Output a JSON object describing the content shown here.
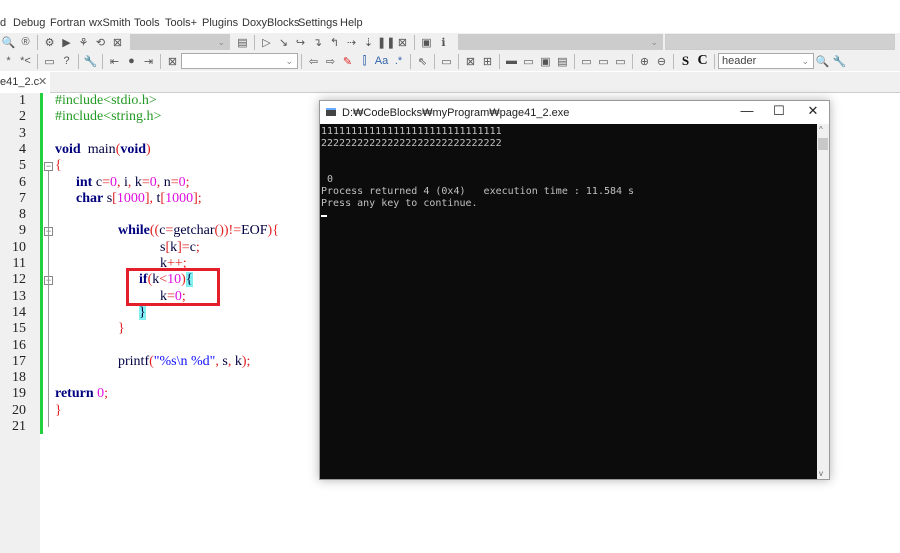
{
  "menu": [
    "d",
    "Debug",
    "Fortran",
    "wxSmith",
    "Tools",
    "Tools+",
    "Plugins",
    "DoxyBlocks",
    "Settings",
    "Help"
  ],
  "toolbar": {
    "target_combo": "",
    "search_combo": "",
    "symbol_combo": "header"
  },
  "tab": {
    "label": "e41_2.c",
    "close": "✕"
  },
  "editor": {
    "line_numbers": [
      "1",
      "2",
      "3",
      "4",
      "5",
      "6",
      "7",
      "8",
      "9",
      "10",
      "11",
      "12",
      "13",
      "14",
      "15",
      "16",
      "17",
      "18",
      "19",
      "20",
      "21"
    ],
    "lines": [
      [
        [
          "pp",
          "#include<stdio.h>"
        ]
      ],
      [
        [
          "pp",
          "#include<string.h>"
        ]
      ],
      [],
      [
        [
          "kw",
          "void"
        ],
        [
          "",
          "  main"
        ],
        [
          "op",
          "("
        ],
        [
          "kw",
          "void"
        ],
        [
          "op",
          ")"
        ]
      ],
      [
        [
          "op",
          "{"
        ]
      ],
      [
        [
          "",
          "      "
        ],
        [
          "kw",
          "int"
        ],
        [
          "",
          " c"
        ],
        [
          "op",
          "="
        ],
        [
          "num",
          "0"
        ],
        [
          "op",
          ","
        ],
        [
          "",
          " i"
        ],
        [
          "op",
          ","
        ],
        [
          "",
          " k"
        ],
        [
          "op",
          "="
        ],
        [
          "num",
          "0"
        ],
        [
          "op",
          ","
        ],
        [
          "",
          " n"
        ],
        [
          "op",
          "="
        ],
        [
          "num",
          "0"
        ],
        [
          "op",
          ";"
        ]
      ],
      [
        [
          "",
          "      "
        ],
        [
          "kw",
          "char"
        ],
        [
          "",
          " s"
        ],
        [
          "op",
          "["
        ],
        [
          "num",
          "1000"
        ],
        [
          "op",
          "]"
        ],
        [
          "op",
          ","
        ],
        [
          "",
          " t"
        ],
        [
          "op",
          "["
        ],
        [
          "num",
          "1000"
        ],
        [
          "op",
          "]"
        ],
        [
          "op",
          ";"
        ]
      ],
      [],
      [
        [
          "",
          "                  "
        ],
        [
          "kw",
          "while"
        ],
        [
          "op",
          "(("
        ],
        [
          "",
          "c"
        ],
        [
          "op",
          "="
        ],
        [
          "",
          "getchar"
        ],
        [
          "op",
          "())!="
        ],
        [
          "",
          "EOF"
        ],
        [
          "op",
          ")"
        ],
        [
          "op",
          "{"
        ]
      ],
      [
        [
          "",
          "                              "
        ],
        [
          "",
          "s"
        ],
        [
          "op",
          "["
        ],
        [
          "",
          "k"
        ],
        [
          "op",
          "]="
        ],
        [
          "",
          "c"
        ],
        [
          "op",
          ";"
        ]
      ],
      [
        [
          "",
          "                              "
        ],
        [
          "",
          "k"
        ],
        [
          "op",
          "++;"
        ]
      ],
      [
        [
          "",
          "                        "
        ],
        [
          "kw",
          "if"
        ],
        [
          "op",
          "("
        ],
        [
          "",
          "k"
        ],
        [
          "op",
          "<"
        ],
        [
          "num",
          "10"
        ],
        [
          "op",
          ")"
        ],
        [
          "hl",
          "{"
        ]
      ],
      [
        [
          "",
          "                              "
        ],
        [
          "",
          "k"
        ],
        [
          "op",
          "="
        ],
        [
          "num",
          "0"
        ],
        [
          "op",
          ";"
        ]
      ],
      [
        [
          "",
          "                        "
        ],
        [
          "hl",
          "}"
        ]
      ],
      [
        [
          "",
          "                  "
        ],
        [
          "op",
          "}"
        ]
      ],
      [],
      [
        [
          "",
          "                  "
        ],
        [
          "",
          "printf"
        ],
        [
          "op",
          "("
        ],
        [
          "str",
          "\"%s\\n %d\""
        ],
        [
          "op",
          ","
        ],
        [
          "",
          " s"
        ],
        [
          "op",
          ","
        ],
        [
          "",
          " k"
        ],
        [
          "op",
          ");"
        ]
      ],
      [],
      [
        [
          "kw",
          "return"
        ],
        [
          "",
          " "
        ],
        [
          "num",
          "0"
        ],
        [
          "op",
          ";"
        ]
      ],
      [
        [
          "op",
          "}"
        ]
      ],
      []
    ]
  },
  "console": {
    "title": "D:₩CodeBlocks₩myProgram₩page41_2.exe",
    "minimize": "—",
    "maximize": "☐",
    "close": "✕",
    "lines": [
      "111111111111111111111111111111",
      "222222222222222222222222222222",
      "",
      "",
      " 0",
      "Process returned 4 (0x4)   execution time : 11.584 s",
      "Press any key to continue."
    ]
  },
  "colors": {
    "highlight_box": "#e41e2a",
    "change_bar": "#22d040",
    "console_bg": "#0c0c0c"
  }
}
